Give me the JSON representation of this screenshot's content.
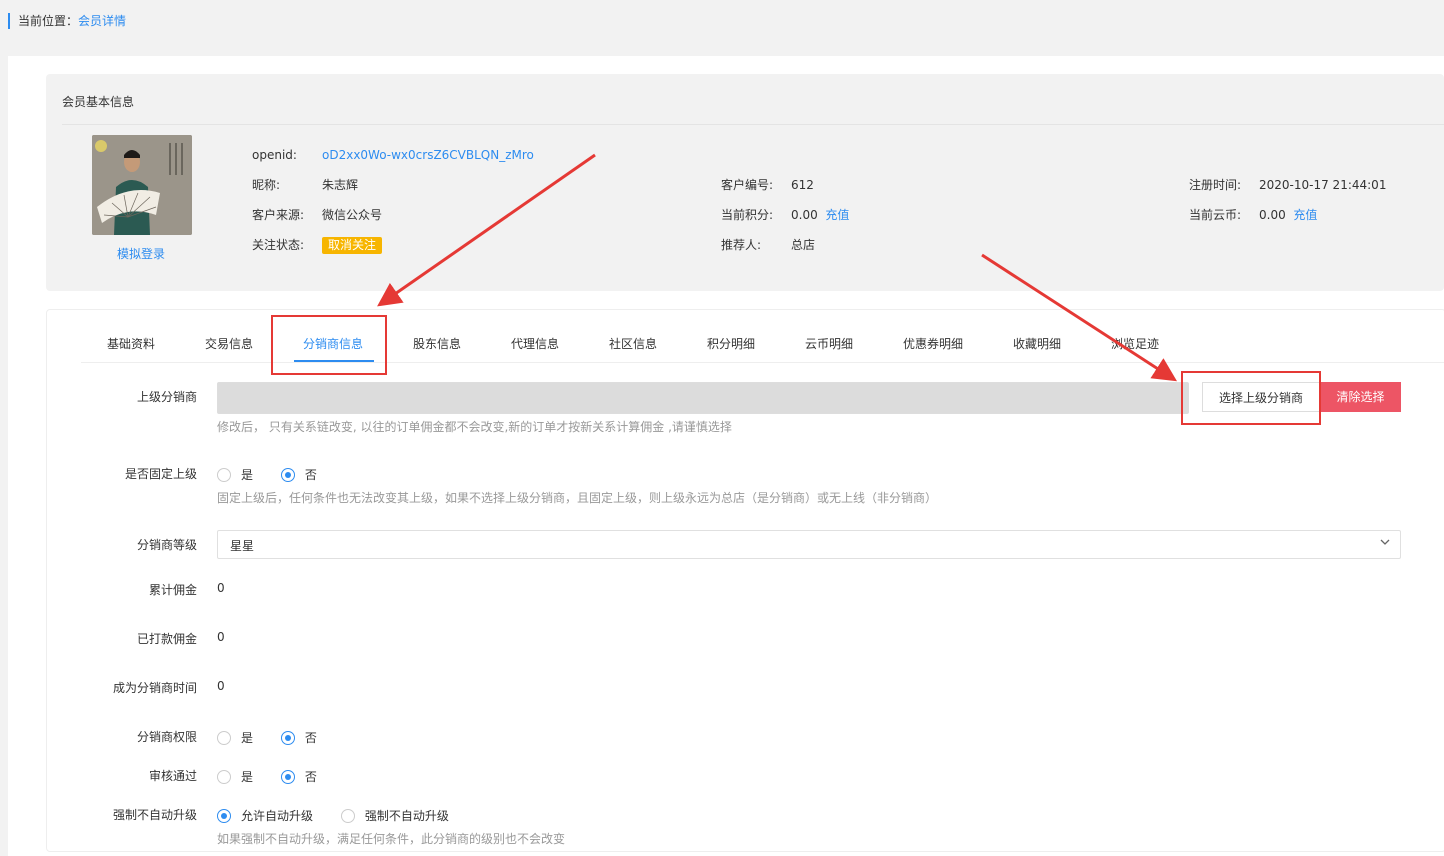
{
  "breadcrumb": {
    "prefix": "当前位置：",
    "current": "会员详情"
  },
  "member_card": {
    "title": "会员基本信息",
    "simulate_login": "模拟登录",
    "openid": {
      "label": "openid:",
      "value": "oD2xx0Wo-wx0crsZ6CVBLQN_zMro"
    },
    "nickname": {
      "label": "昵称:",
      "value": "朱志辉"
    },
    "source": {
      "label": "客户来源:",
      "value": "微信公众号"
    },
    "follow_status": {
      "label": "关注状态:",
      "value": "取消关注"
    },
    "customer_no": {
      "label": "客户编号:",
      "value": "612"
    },
    "points": {
      "label": "当前积分:",
      "value": "0.00",
      "action": "充值"
    },
    "referrer": {
      "label": "推荐人:",
      "value": "总店"
    },
    "register_time": {
      "label": "注册时间:",
      "value": "2020-10-17 21:44:01"
    },
    "cloud_coins": {
      "label": "当前云币:",
      "value": "0.00",
      "action": "充值"
    }
  },
  "tabs": [
    {
      "label": "基础资料"
    },
    {
      "label": "交易信息"
    },
    {
      "label": "分销商信息"
    },
    {
      "label": "股东信息"
    },
    {
      "label": "代理信息"
    },
    {
      "label": "社区信息"
    },
    {
      "label": "积分明细"
    },
    {
      "label": "云币明细"
    },
    {
      "label": "优惠券明细"
    },
    {
      "label": "收藏明细"
    },
    {
      "label": "浏览足迹"
    }
  ],
  "active_tab": "分销商信息",
  "form": {
    "parent": {
      "label": "上级分销商",
      "select_button": "选择上级分销商",
      "clear_button": "清除选择",
      "help": "修改后， 只有关系链改变, 以往的订单佣金都不会改变,新的订单才按新关系计算佣金 ,请谨慎选择"
    },
    "fixed_parent": {
      "label": "是否固定上级",
      "options": [
        "是",
        "否"
      ],
      "selected": "否",
      "help": "固定上级后，任何条件也无法改变其上级，如果不选择上级分销商，且固定上级，则上级永远为总店（是分销商）或无上线（非分销商）"
    },
    "level": {
      "label": "分销商等级",
      "value": "星星"
    },
    "total_commission": {
      "label": "累计佣金",
      "value": "0"
    },
    "paid_commission": {
      "label": "已打款佣金",
      "value": "0"
    },
    "become_time": {
      "label": "成为分销商时间",
      "value": "0"
    },
    "permission": {
      "label": "分销商权限",
      "options": [
        "是",
        "否"
      ],
      "selected": "否"
    },
    "approved": {
      "label": "审核通过",
      "options": [
        "是",
        "否"
      ],
      "selected": "否"
    },
    "auto_upgrade": {
      "label": "强制不自动升级",
      "options": [
        "允许自动升级",
        "强制不自动升级"
      ],
      "selected": "允许自动升级",
      "help": "如果强制不自动升级，满足任何条件，此分销商的级别也不会改变"
    }
  },
  "colors": {
    "accent": "#2d8cf0",
    "danger": "#ed5565",
    "badge": "#f7b500",
    "annotation": "#e53935"
  }
}
